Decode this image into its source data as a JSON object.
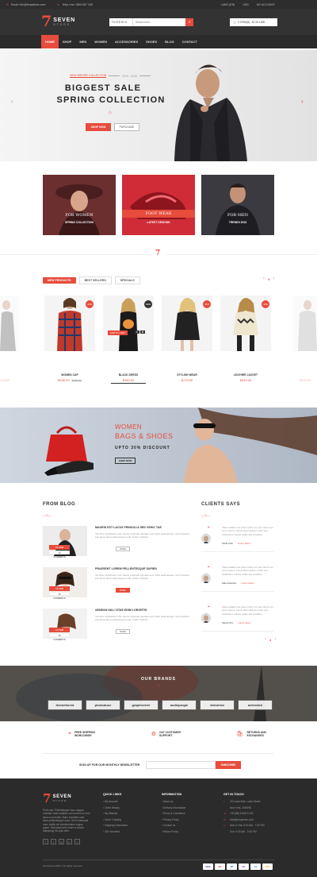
{
  "topbar": {
    "email": "Email: info@templness.com",
    "help": "Help Line: 0800 567 345",
    "language": "LANG (EN)",
    "currency": "USD",
    "account": "MY ACCOUNT"
  },
  "header": {
    "logo_number": "7",
    "logo_text": "SEVEN",
    "logo_sub": "STORE",
    "filter_label": "FILTER BY",
    "search_placeholder": "Search here...",
    "cart_text": "2 ITEM(S) - $7.00 USD"
  },
  "nav": {
    "items": [
      "HOME",
      "SHOP",
      "MEN",
      "WOMEN",
      "ACCESSORIES",
      "SHOES",
      "BLOG",
      "CONTACT"
    ]
  },
  "hero": {
    "kicker": "NEW WINTER COLLECTION",
    "years": "2015 - 2016",
    "title_line1": "BIGGEST SALE",
    "title_line2": "SPRING COLLECTION",
    "shop_button": "SHOP NOW",
    "purchase_button": "PURCHASE"
  },
  "categories": [
    {
      "title": "FOR WOMEN",
      "sub": "SPRING COLLECTION"
    },
    {
      "title": "FOOT WEAR",
      "sub": "LATEST DESIGNS"
    },
    {
      "title": "FOR MEN",
      "sub": "TRENDS 2016"
    }
  ],
  "products_section": {
    "divider_glyph": "7",
    "tabs": [
      "NEW PRODUCTS",
      "BEST SELLERS",
      "SPECIALS"
    ],
    "nav_prev": "‹",
    "nav_next": "›",
    "items": [
      {
        "name": "WOMEN CAP",
        "price": "$240.00",
        "old_price": "$285.00",
        "badge": "-15%"
      },
      {
        "name": "BLACK DRESS",
        "price": "$160.00",
        "badge": "NEW",
        "add_to_cart": "ADD TO CART"
      },
      {
        "name": "STYLISH WEAR",
        "price": "$179.00",
        "badge": "-15%"
      },
      {
        "name": "LEATHER JACKET",
        "price": "$310.00",
        "badge": "-15%"
      }
    ],
    "partial_left_price": "179.00",
    "partial_right_price": "$179.00"
  },
  "promo": {
    "line1": "WOMEN",
    "line2": "BAGS & SHOES",
    "line3": "UPTO 30% DISCOUNT",
    "button": "SHOP NOW"
  },
  "blog": {
    "title": "FROM BLOG",
    "posts": [
      {
        "date": "15 FEB",
        "comments": "15 COMMENTS",
        "title": "MAURIS EST LACUS FRINGILLA SED VEHIC TAE",
        "excerpt": "Vel dolor Vestibulum erat maurie vulputate ulputate sed mollis pellentesque. Nec tincidunt erat lacus lacus pellentesque nullo mollis curabitur.",
        "button": "MORE"
      },
      {
        "date": "15 FEB",
        "comments": "15 COMMENTS",
        "title": "PRAESENT LOREM PELLENTESQUE SAPIEN",
        "excerpt": "Vel dolor Vestibulum erat maurie vulputate ulputate sed mollis pellentesque. Nec tincidunt erat lacus lacus pellentesque nullo mollis curabitur.",
        "button": "MORE"
      },
      {
        "date": "15 FEB",
        "comments": "15 COMMENTS",
        "title": "AENEAN NULI VITAE ENIM LOBORTIS",
        "excerpt": "Vel dolor Vestibulum erat maurie vulputate ulputate sed mollis pellentesque. Nec tincidunt erat lacus lacus pellentesque nullo mollis curabitur.",
        "button": "MORE"
      }
    ]
  },
  "clients": {
    "title": "CLIENTS SAYS",
    "items": [
      {
        "quote": "Vitae sodales nisi justo morbi non sem lacus non lorem ipsum. Lacus lacus aliquet morbi sed vestibulum massa mollis sed curabitur.",
        "name": "Smith John",
        "role": "Lorem Ipsum"
      },
      {
        "quote": "Vitae sodales nisi justo morbi non sem lacus non lorem ipsum. Lacus lacus aliquet morbi sed vestibulum massa mollis sed curabitur.",
        "name": "Kate Anderson",
        "role": "Lorem Ipsum"
      },
      {
        "quote": "Vitae sodales nisi justo morbi non sem lacus non lorem ipsum. Lacus lacus aliquet morbi sed vestibulum massa mollis sed curabitur.",
        "name": "Steven Kim",
        "role": "Lorem Ipsum"
      }
    ]
  },
  "brands": {
    "title": "OUR BRANDS",
    "items": [
      "themeforest",
      "photodune",
      "graphicriver",
      "audiojungle",
      "videohive",
      "activeden"
    ]
  },
  "features": [
    {
      "line1": "FREE SHIPPING",
      "line2": "WORLDWIDE",
      "icon": "map-pin-icon"
    },
    {
      "line1": "24/7 CUSTOMER",
      "line2": "SUPPORT",
      "icon": "support-icon"
    },
    {
      "line1": "RETURNS AND",
      "line2": "EXCHANGES",
      "icon": "shopping-bag-icon"
    }
  ],
  "newsletter": {
    "label": "SIGN UP FOR OUR MONTHLY NEWSLETTER",
    "placeholder": "",
    "button": "SUBSCRIBE"
  },
  "footer": {
    "logo_number": "7",
    "logo_text": "SEVEN",
    "logo_sub": "STORE",
    "about": "Proin nisl. Pellentesque risus magna molestie vitae sodales non morbi non sem lacus non mollis. Nunc curabitur aum lacus pellentesque nunc. Sed consequat nunc mollis vel condimentum augue quam. Sed placerat ut enim in auctor adipiscing vel quis nibh.",
    "quick_links_title": "QUICK LINKS",
    "quick_links": [
      "My Account",
      "Order History",
      "My Wishlist",
      "Order Tracking",
      "Shipping Information",
      "Gift Vouchers"
    ],
    "info_title": "INFORMATION",
    "info_links": [
      "About us",
      "Delivery Information",
      "Terms & Conditions",
      "Privacy Policy",
      "Contact us",
      "Return Policy"
    ],
    "contact_title": "GET IN TOUCH",
    "contact": [
      "23 Ducia Mall, Lorim Street",
      "New York, 2000RB",
      "+00 (88) 5 645 6 232",
      "info@templness.com",
      "Mon to Sat: 8.00 AM - 7.00 PM",
      "Sun: 9.00 AM - 5.00 PM"
    ],
    "copyright": "Templness 2015 © All rights reserved",
    "payments": [
      "VISA",
      "MC",
      "PP",
      "DC",
      "AE",
      "DSC"
    ]
  },
  "colors": {
    "accent": "#e74c3c",
    "dark": "#2b2b2b"
  }
}
